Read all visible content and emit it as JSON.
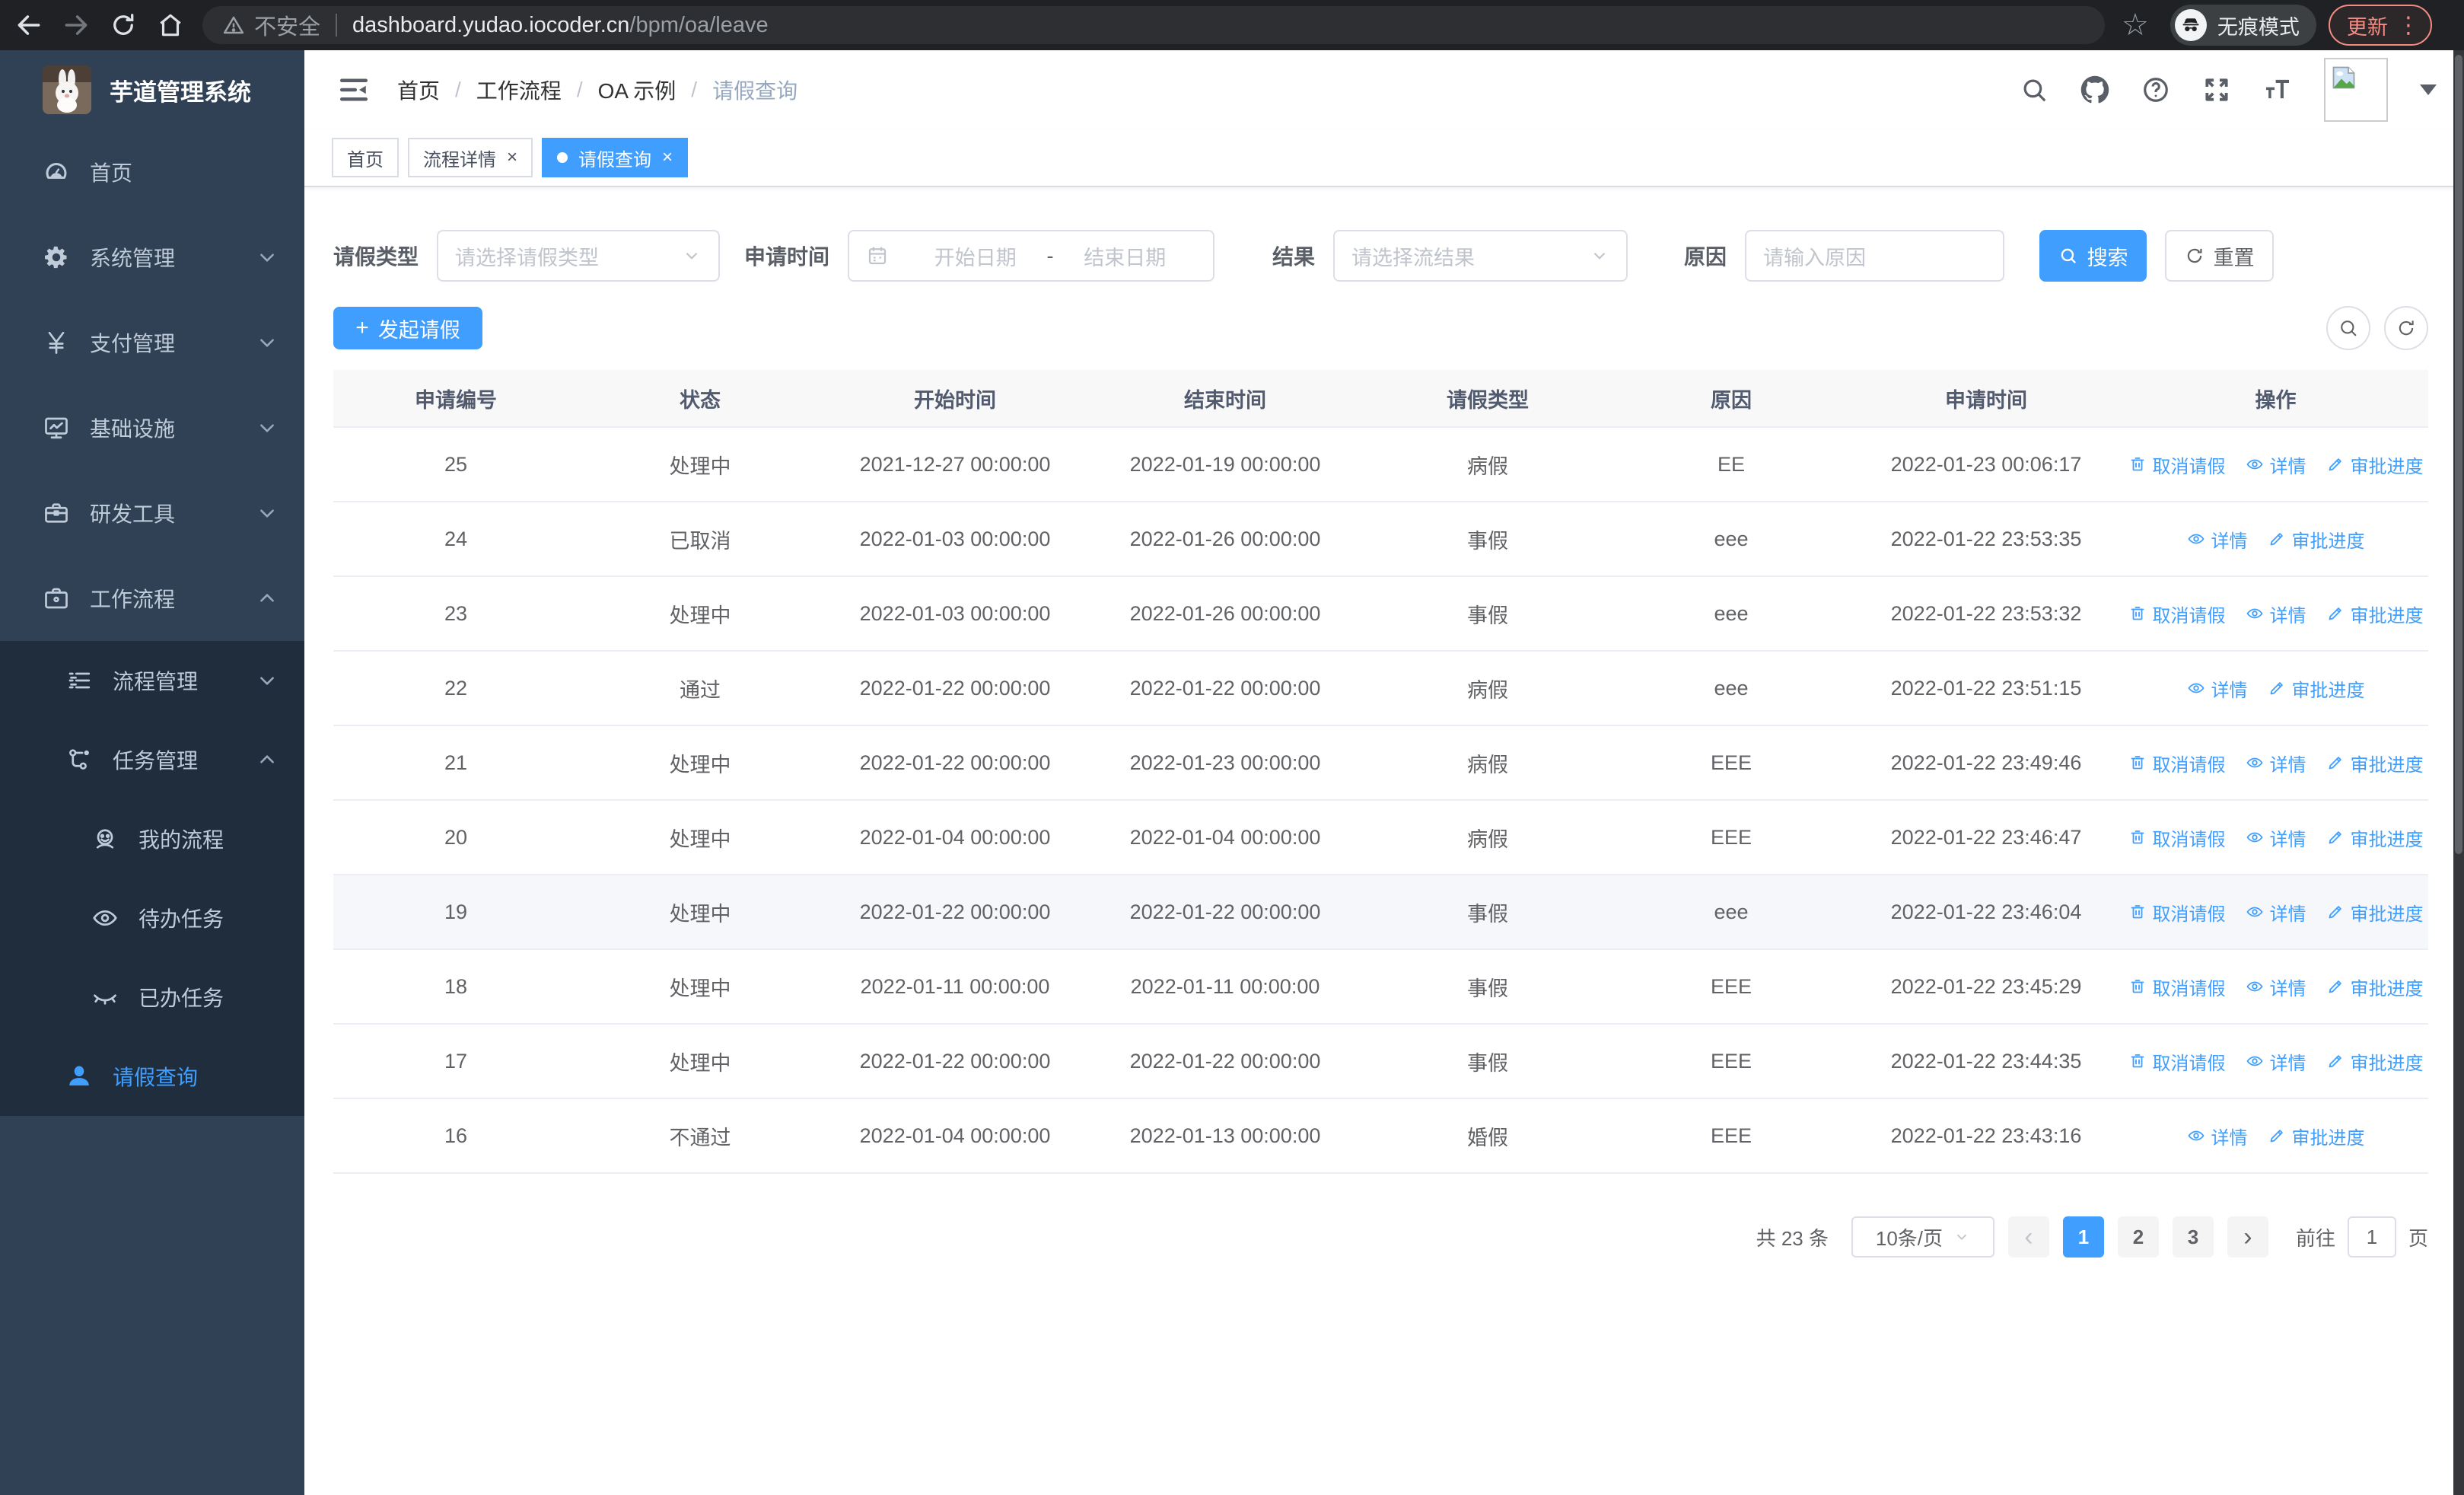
{
  "browser": {
    "security_label": "不安全",
    "url_host": "dashboard.yudao.iocoder.cn",
    "url_path": "/bpm/oa/leave",
    "incognito_label": "无痕模式",
    "update_label": "更新"
  },
  "icons": {
    "bookmark_star": "☆",
    "menu_dots": "⋮",
    "close": "×",
    "prev_arrow": "‹",
    "next_arrow": "›",
    "plus": "+",
    "date_separator": "-"
  },
  "sidebar": {
    "title": "芋道管理系统",
    "menu": [
      {
        "key": "home",
        "label": "首页",
        "icon": "dashboard-icon",
        "level": 1
      },
      {
        "key": "system",
        "label": "系统管理",
        "icon": "gear-icon",
        "level": 1,
        "arrow": "down"
      },
      {
        "key": "payment",
        "label": "支付管理",
        "icon": "yen-icon",
        "level": 1,
        "arrow": "down"
      },
      {
        "key": "infra",
        "label": "基础设施",
        "icon": "monitor-icon",
        "level": 1,
        "arrow": "down"
      },
      {
        "key": "devtools",
        "label": "研发工具",
        "icon": "toolbox-icon",
        "level": 1,
        "arrow": "down"
      },
      {
        "key": "workflow",
        "label": "工作流程",
        "icon": "briefcase-icon",
        "level": 1,
        "arrow": "up"
      },
      {
        "key": "process-mgmt",
        "label": "流程管理",
        "icon": "list-icon",
        "level": 2,
        "arrow": "down",
        "submenu": true
      },
      {
        "key": "task-mgmt",
        "label": "任务管理",
        "icon": "flow-icon",
        "level": 2,
        "arrow": "up",
        "submenu": true
      },
      {
        "key": "my-process",
        "label": "我的流程",
        "icon": "face-icon",
        "level": 3,
        "submenu": true
      },
      {
        "key": "todo-tasks",
        "label": "待办任务",
        "icon": "eye-icon",
        "level": 3,
        "submenu": true
      },
      {
        "key": "done-tasks",
        "label": "已办任务",
        "icon": "eye-closed-icon",
        "level": 3,
        "submenu": true
      },
      {
        "key": "leave-query",
        "label": "请假查询",
        "icon": "user-icon",
        "level": 2,
        "submenu": true,
        "active": true
      }
    ]
  },
  "header": {
    "breadcrumb": [
      "首页",
      "工作流程",
      "OA 示例",
      "请假查询"
    ]
  },
  "tabs": [
    {
      "label": "首页",
      "active": false,
      "closable": false
    },
    {
      "label": "流程详情",
      "active": false,
      "closable": true
    },
    {
      "label": "请假查询",
      "active": true,
      "closable": true
    }
  ],
  "filters": {
    "leave_type_label": "请假类型",
    "leave_type_placeholder": "请选择请假类型",
    "apply_time_label": "申请时间",
    "date_start_placeholder": "开始日期",
    "date_end_placeholder": "结束日期",
    "result_label": "结果",
    "result_placeholder": "请选择流结果",
    "reason_label": "原因",
    "reason_placeholder": "请输入原因",
    "search_label": "搜索",
    "reset_label": "重置"
  },
  "toolbar": {
    "create_label": "发起请假"
  },
  "table": {
    "columns": [
      "申请编号",
      "状态",
      "开始时间",
      "结束时间",
      "请假类型",
      "原因",
      "申请时间",
      "操作"
    ],
    "action_labels": {
      "cancel": "取消请假",
      "detail": "详情",
      "progress": "审批进度"
    },
    "rows": [
      {
        "id": "25",
        "status": "处理中",
        "start": "2021-12-27 00:00:00",
        "end": "2022-01-19 00:00:00",
        "type": "病假",
        "reason": "EE",
        "applied": "2022-01-23 00:06:17",
        "actions": [
          "cancel",
          "detail",
          "progress"
        ],
        "hover": false
      },
      {
        "id": "24",
        "status": "已取消",
        "start": "2022-01-03 00:00:00",
        "end": "2022-01-26 00:00:00",
        "type": "事假",
        "reason": "eee",
        "applied": "2022-01-22 23:53:35",
        "actions": [
          "detail",
          "progress"
        ],
        "hover": false
      },
      {
        "id": "23",
        "status": "处理中",
        "start": "2022-01-03 00:00:00",
        "end": "2022-01-26 00:00:00",
        "type": "事假",
        "reason": "eee",
        "applied": "2022-01-22 23:53:32",
        "actions": [
          "cancel",
          "detail",
          "progress"
        ],
        "hover": false
      },
      {
        "id": "22",
        "status": "通过",
        "start": "2022-01-22 00:00:00",
        "end": "2022-01-22 00:00:00",
        "type": "病假",
        "reason": "eee",
        "applied": "2022-01-22 23:51:15",
        "actions": [
          "detail",
          "progress"
        ],
        "hover": false
      },
      {
        "id": "21",
        "status": "处理中",
        "start": "2022-01-22 00:00:00",
        "end": "2022-01-23 00:00:00",
        "type": "病假",
        "reason": "EEE",
        "applied": "2022-01-22 23:49:46",
        "actions": [
          "cancel",
          "detail",
          "progress"
        ],
        "hover": false
      },
      {
        "id": "20",
        "status": "处理中",
        "start": "2022-01-04 00:00:00",
        "end": "2022-01-04 00:00:00",
        "type": "病假",
        "reason": "EEE",
        "applied": "2022-01-22 23:46:47",
        "actions": [
          "cancel",
          "detail",
          "progress"
        ],
        "hover": false
      },
      {
        "id": "19",
        "status": "处理中",
        "start": "2022-01-22 00:00:00",
        "end": "2022-01-22 00:00:00",
        "type": "事假",
        "reason": "eee",
        "applied": "2022-01-22 23:46:04",
        "actions": [
          "cancel",
          "detail",
          "progress"
        ],
        "hover": true
      },
      {
        "id": "18",
        "status": "处理中",
        "start": "2022-01-11 00:00:00",
        "end": "2022-01-11 00:00:00",
        "type": "事假",
        "reason": "EEE",
        "applied": "2022-01-22 23:45:29",
        "actions": [
          "cancel",
          "detail",
          "progress"
        ],
        "hover": false
      },
      {
        "id": "17",
        "status": "处理中",
        "start": "2022-01-22 00:00:00",
        "end": "2022-01-22 00:00:00",
        "type": "事假",
        "reason": "EEE",
        "applied": "2022-01-22 23:44:35",
        "actions": [
          "cancel",
          "detail",
          "progress"
        ],
        "hover": false
      },
      {
        "id": "16",
        "status": "不通过",
        "start": "2022-01-04 00:00:00",
        "end": "2022-01-13 00:00:00",
        "type": "婚假",
        "reason": "EEE",
        "applied": "2022-01-22 23:43:16",
        "actions": [
          "detail",
          "progress"
        ],
        "hover": false
      }
    ]
  },
  "pagination": {
    "total_label": "共 23 条",
    "page_size": "10条/页",
    "pages": [
      "1",
      "2",
      "3"
    ],
    "active_page": "1",
    "goto_label": "前往",
    "goto_value": "1",
    "goto_suffix": "页"
  },
  "colors": {
    "primary": "#409eff",
    "sidebar_bg": "#304156",
    "submenu_bg": "#1f2d3d"
  }
}
